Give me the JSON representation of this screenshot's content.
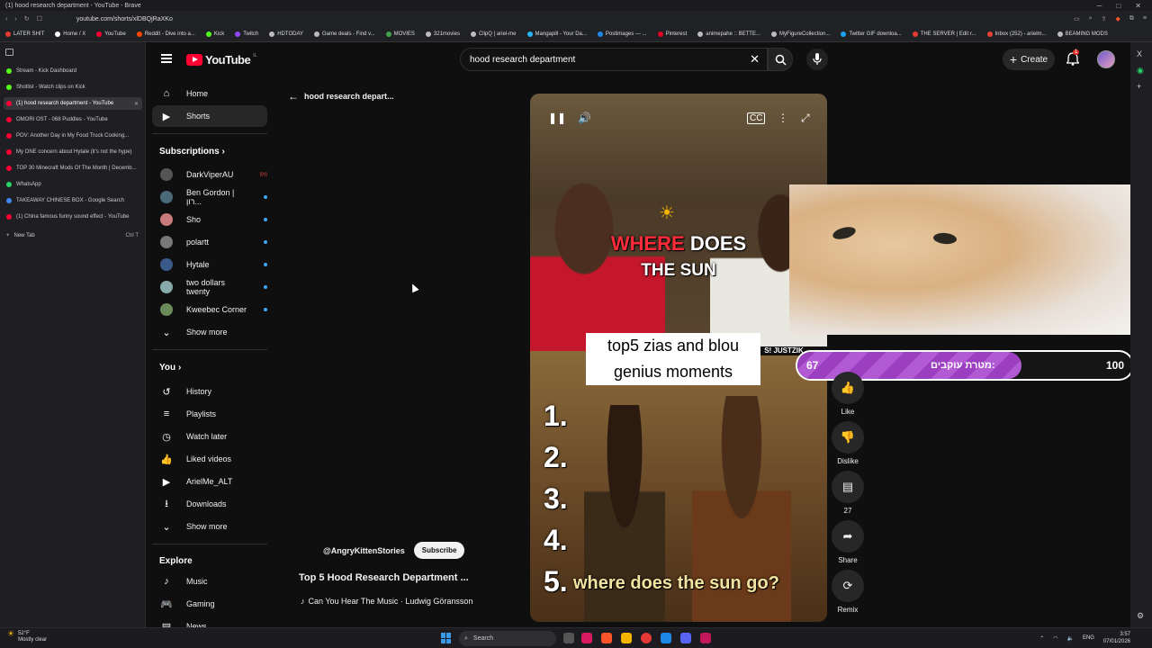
{
  "window": {
    "title": "(1) hood research department - YouTube - Brave",
    "url": "youtube.com/shorts/xlDBQjRaXKo",
    "controls": [
      "─",
      "□",
      "✕"
    ]
  },
  "bookmarks": [
    {
      "label": "LATER SHIT",
      "color": "#e53935"
    },
    {
      "label": "Home / X",
      "color": "#ffffff"
    },
    {
      "label": "YouTube",
      "color": "#ff0033"
    },
    {
      "label": "Reddit - Dive into a...",
      "color": "#ff4500"
    },
    {
      "label": "Kick",
      "color": "#53fc18"
    },
    {
      "label": "Twitch",
      "color": "#9146ff"
    },
    {
      "label": "HDTODAY",
      "color": "#bbbbbb"
    },
    {
      "label": "Game deals - Find v...",
      "color": "#bbbbbb"
    },
    {
      "label": "MOVIES",
      "color": "#43a047"
    },
    {
      "label": "321movies",
      "color": "#bbbbbb"
    },
    {
      "label": "ClipQ | ariel-me",
      "color": "#bbbbbb"
    },
    {
      "label": "Mangapill - Your Da...",
      "color": "#29b6f6"
    },
    {
      "label": "Postimages — ...",
      "color": "#1e88e5"
    },
    {
      "label": "Pinterest",
      "color": "#e60023"
    },
    {
      "label": "animepahe :: BETTE...",
      "color": "#bbbbbb"
    },
    {
      "label": "MyFigureCollection...",
      "color": "#bbbbbb"
    },
    {
      "label": "Twitter GIF downloa...",
      "color": "#1da1f2"
    },
    {
      "label": "THE SERVER | Edit r...",
      "color": "#e53935"
    },
    {
      "label": "Inbox (252) - arielm...",
      "color": "#ea4335"
    },
    {
      "label": "BEAMING MODS",
      "color": "#bbbbbb"
    }
  ],
  "tabs": [
    {
      "label": "Stream - Kick Dashboard",
      "color": "#53fc18",
      "active": false
    },
    {
      "label": "Shotlist - Watch clips on Kick",
      "color": "#53fc18",
      "active": false
    },
    {
      "label": "(1) hood research department - YouTube",
      "color": "#ff0033",
      "active": true
    },
    {
      "label": "OMORI OST - 068 Puddles - YouTube",
      "color": "#ff0033",
      "active": false
    },
    {
      "label": "POV: Another Day in My Food Truck Cooking...",
      "color": "#ff0033",
      "active": false
    },
    {
      "label": "My ONE concern about Hytale (it's not the hype)",
      "color": "#ff0033",
      "active": false
    },
    {
      "label": "TOP 30 Minecraft Mods Of The Month | Decemb...",
      "color": "#ff0033",
      "active": false
    },
    {
      "label": "WhatsApp",
      "color": "#25d366",
      "active": false
    },
    {
      "label": "TAKEAWAY CHINESE BOX - Google Search",
      "color": "#4285f4",
      "active": false
    },
    {
      "label": "(1) China famous funny sound effect - YouTube",
      "color": "#ff0033",
      "active": false
    }
  ],
  "new_tab": {
    "label": "New Tab",
    "shortcut": "Ctrl T"
  },
  "header": {
    "logo_text": "YouTube",
    "logo_country": "IL",
    "search_value": "hood research department",
    "create_label": "Create",
    "notification_count": "1"
  },
  "sidebar": {
    "main": [
      {
        "label": "Home",
        "icon": "⌂"
      },
      {
        "label": "Shorts",
        "icon": "▶"
      }
    ],
    "subscriptions_title": "Subscriptions",
    "subscriptions": [
      {
        "label": "DarkViperAU",
        "color": "#555"
      },
      {
        "label": "Ben Gordon | רון...",
        "color": "#4a6a7a"
      },
      {
        "label": "Sho",
        "color": "#c97a7a"
      },
      {
        "label": "polartt",
        "color": "#777"
      },
      {
        "label": "Hytale",
        "color": "#3a5a8a"
      },
      {
        "label": "two dollars twenty",
        "color": "#8aa"
      },
      {
        "label": "Kweebec Corner",
        "color": "#6a8a5a"
      }
    ],
    "subs_show_more": "Show more",
    "you_title": "You",
    "you_items": [
      {
        "label": "History",
        "icon": "↺"
      },
      {
        "label": "Playlists",
        "icon": "≡"
      },
      {
        "label": "Watch later",
        "icon": "◷"
      },
      {
        "label": "Liked videos",
        "icon": "👍"
      },
      {
        "label": "ArielMe_ALT",
        "icon": "▶"
      },
      {
        "label": "Downloads",
        "icon": "⭳"
      }
    ],
    "you_show_more": "Show more",
    "explore_title": "Explore",
    "explore_items": [
      {
        "label": "Music",
        "icon": "♪"
      },
      {
        "label": "Gaming",
        "icon": "🎮"
      },
      {
        "label": "News",
        "icon": "▤"
      }
    ]
  },
  "shorts": {
    "back_label": "hood research depart...",
    "caption_where": "WHERE",
    "caption_does": "DOES",
    "caption_sun": "THE SUN",
    "box_line1": "top5 zias and blou",
    "box_line2": "genius moments",
    "numbers": [
      "1.",
      "2.",
      "3.",
      "4.",
      "5."
    ],
    "bottom_caption": "where does the sun go?",
    "handle_overlay": "S! JUSTZIK",
    "channel": "@AngryKittenStories",
    "subscribe_label": "Subscribe",
    "title": "Top 5 Hood Research Department ...",
    "music": "Can You Hear The Music · Ludwig Göransson",
    "actions": {
      "like": "Like",
      "dislike": "Dislike",
      "comments": "27",
      "share": "Share",
      "remix": "Remix"
    }
  },
  "overlay": {
    "goal_title": "מטרת עוקבים:",
    "goal_current": 67,
    "goal_max": 100,
    "goal_color": "#9b3fc0"
  },
  "taskbar": {
    "temp": "52°F",
    "weather": "Mostly clear",
    "search_label": "Search",
    "lang": "ENG",
    "time": "3:57",
    "date": "07/01/2026"
  }
}
